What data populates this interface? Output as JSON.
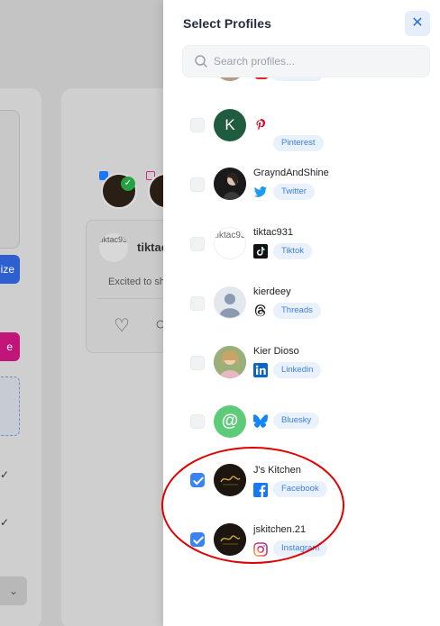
{
  "background": {
    "left_button_1_label": "ize",
    "left_button_2_label": "e",
    "post": {
      "avatar_alt": "tiktac931",
      "name": "tiktac",
      "text": "Excited to sh"
    }
  },
  "panel": {
    "title": "Select Profiles",
    "close_label": "✕",
    "search": {
      "placeholder": "Search profiles..."
    },
    "profiles": [
      {
        "name": "",
        "letter": "K",
        "avatar": "letter",
        "platform": "Pinterest",
        "platform_icon": "pinterest-icon",
        "checked": false
      },
      {
        "name": "GrayndAndShine",
        "avatar": "photo-dark",
        "platform": "Twitter",
        "platform_icon": "twitter-icon",
        "checked": false
      },
      {
        "name": "tiktac931",
        "avatar_alt": "tiktac931",
        "avatar": "broken-image",
        "platform": "Tiktok",
        "platform_icon": "tiktok-icon",
        "checked": false
      },
      {
        "name": "kierdeey",
        "avatar": "default-user",
        "platform": "Threads",
        "platform_icon": "threads-icon",
        "checked": false
      },
      {
        "name": "Kier Dioso",
        "avatar": "photo",
        "platform": "Linkedin",
        "platform_icon": "linkedin-icon",
        "checked": false
      },
      {
        "name": "",
        "avatar": "at-symbol",
        "platform": "Bluesky",
        "platform_icon": "bluesky-icon",
        "checked": false
      },
      {
        "name": "J's Kitchen",
        "avatar": "kitchen-logo",
        "platform": "Facebook",
        "platform_icon": "facebook-icon",
        "checked": true
      },
      {
        "name": "jskitchen.21",
        "avatar": "kitchen-logo",
        "platform": "Instagram",
        "platform_icon": "instagram-icon",
        "checked": true
      }
    ]
  },
  "colors": {
    "accent": "#3b82f6",
    "tag_bg": "#e9f1fd",
    "tag_text": "#3d7fe0",
    "annotation": "#e10000"
  }
}
